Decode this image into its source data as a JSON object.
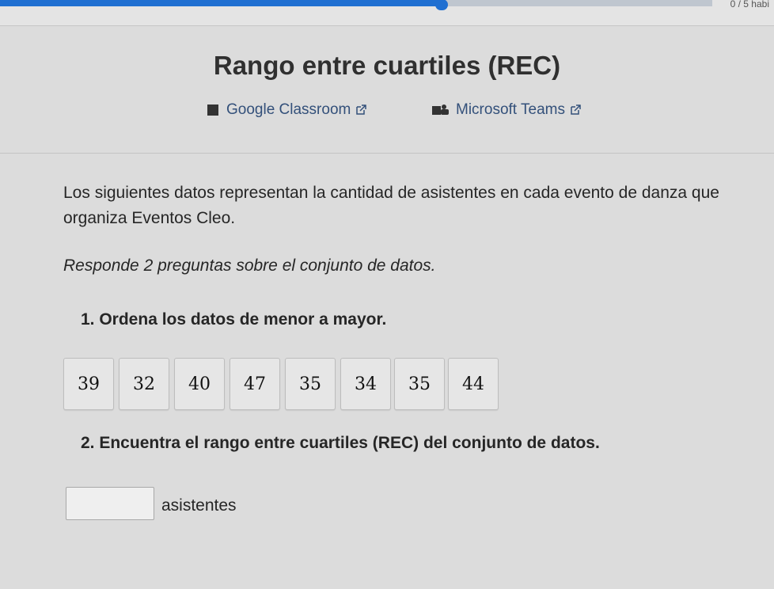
{
  "header": {
    "progress_fraction": 0.62,
    "skills_count_text": "0 / 5 habi"
  },
  "title": "Rango entre cuartiles (REC)",
  "share": {
    "google_classroom": "Google Classroom",
    "microsoft_teams": "Microsoft Teams"
  },
  "problem": {
    "intro": "Los siguientes datos representan la cantidad de asistentes en cada evento de danza que organiza Eventos Cleo.",
    "instructions": "Responde 2 preguntas sobre el conjunto de datos.",
    "question1": "1. Ordena los datos de menor a mayor.",
    "tiles": [
      "39",
      "32",
      "40",
      "47",
      "35",
      "34",
      "35",
      "44"
    ],
    "question2": "2. Encuentra el rango entre cuartiles (REC) del conjunto de datos.",
    "answer_value": "",
    "unit": "asistentes"
  },
  "colors": {
    "accent": "#1f6fd1",
    "link": "#33507a",
    "background": "#dcdcdc"
  },
  "icons": {
    "google_classroom": "google-classroom-icon",
    "microsoft_teams": "microsoft-teams-icon",
    "external_link": "external-link-icon"
  }
}
